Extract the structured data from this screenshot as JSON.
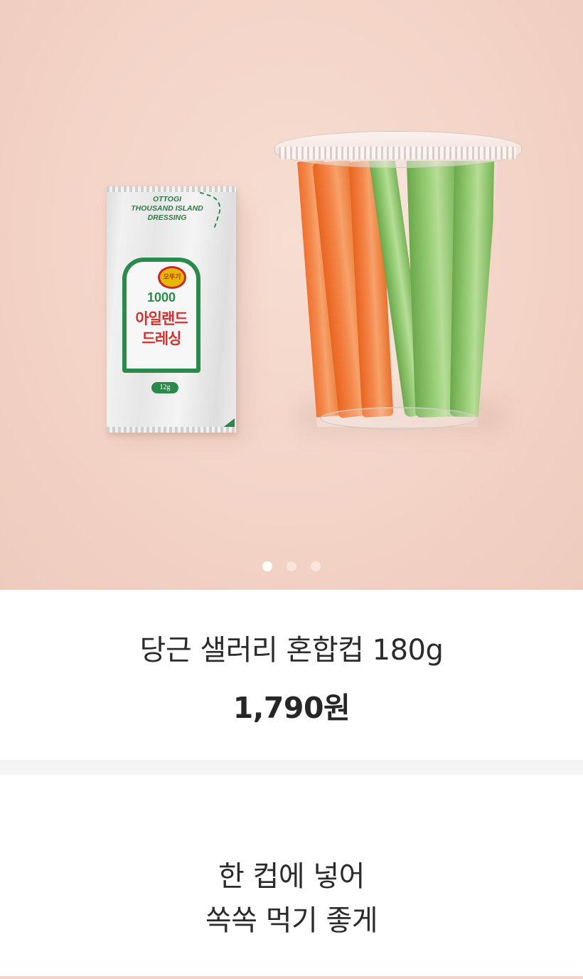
{
  "carousel": {
    "slide_count": 3,
    "active_index": 0,
    "image": {
      "sachet": {
        "brand_lines": "OTTOGI\nTHOUSAND ISLAND\nDRESSING",
        "logo": "오뚜기",
        "number": "1000",
        "name_line1": "아일랜드",
        "name_line2": "드레싱",
        "weight": "12g"
      }
    }
  },
  "product": {
    "title": "당근 샐러리 혼합컵 180g",
    "price": "1,790원"
  },
  "description": {
    "line1": "한 컵에 넣어",
    "line2": "쏙쏙 먹기 좋게"
  },
  "colors": {
    "hero_background": "#f3d4c7",
    "carrot": "#f4874a",
    "celery": "#9fd27e",
    "divider": "#f4f4f4"
  }
}
